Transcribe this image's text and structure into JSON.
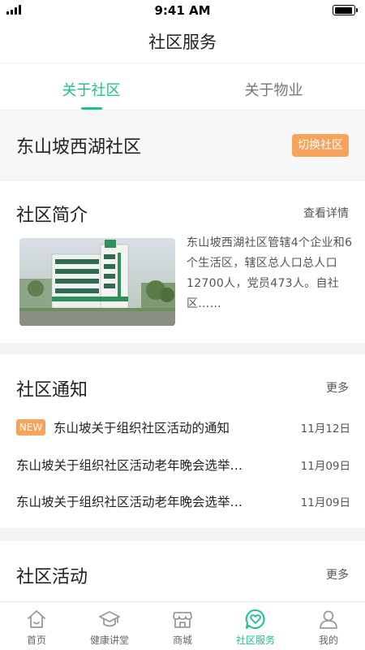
{
  "status_bar": {
    "time": "9:41 AM"
  },
  "header": {
    "title": "社区服务"
  },
  "tabs": [
    {
      "label": "关于社区",
      "active": true
    },
    {
      "label": "关于物业",
      "active": false
    }
  ],
  "community": {
    "name": "东山坡西湖社区",
    "switch_label": "切换社区"
  },
  "intro": {
    "title": "社区简介",
    "more": "查看详情",
    "text": "东山坡西湖社区管辖4个企业和6个生活区，辖区总人口总人口12700人，党员473人。自社区……"
  },
  "notices": {
    "title": "社区通知",
    "more": "更多",
    "badge": "NEW",
    "items": [
      {
        "text": "东山坡关于组织社区活动的通知",
        "date": "11月12日",
        "is_new": true
      },
      {
        "text": "东山坡关于组织社区活动老年晚会选举…",
        "date": "11月09日",
        "is_new": false
      },
      {
        "text": "东山坡关于组织社区活动老年晚会选举…",
        "date": "11月09日",
        "is_new": false
      }
    ]
  },
  "activities": {
    "title": "社区活动",
    "more": "更多"
  },
  "tabbar": {
    "items": [
      {
        "label": "首页",
        "icon": "home-icon"
      },
      {
        "label": "健康讲堂",
        "icon": "graduation-cap-icon"
      },
      {
        "label": "商城",
        "icon": "store-icon"
      },
      {
        "label": "社区服务",
        "icon": "heart-bubble-icon",
        "active": true
      },
      {
        "label": "我的",
        "icon": "user-icon"
      }
    ]
  },
  "colors": {
    "accent": "#1fc08e",
    "orange": "#f7a35c"
  }
}
